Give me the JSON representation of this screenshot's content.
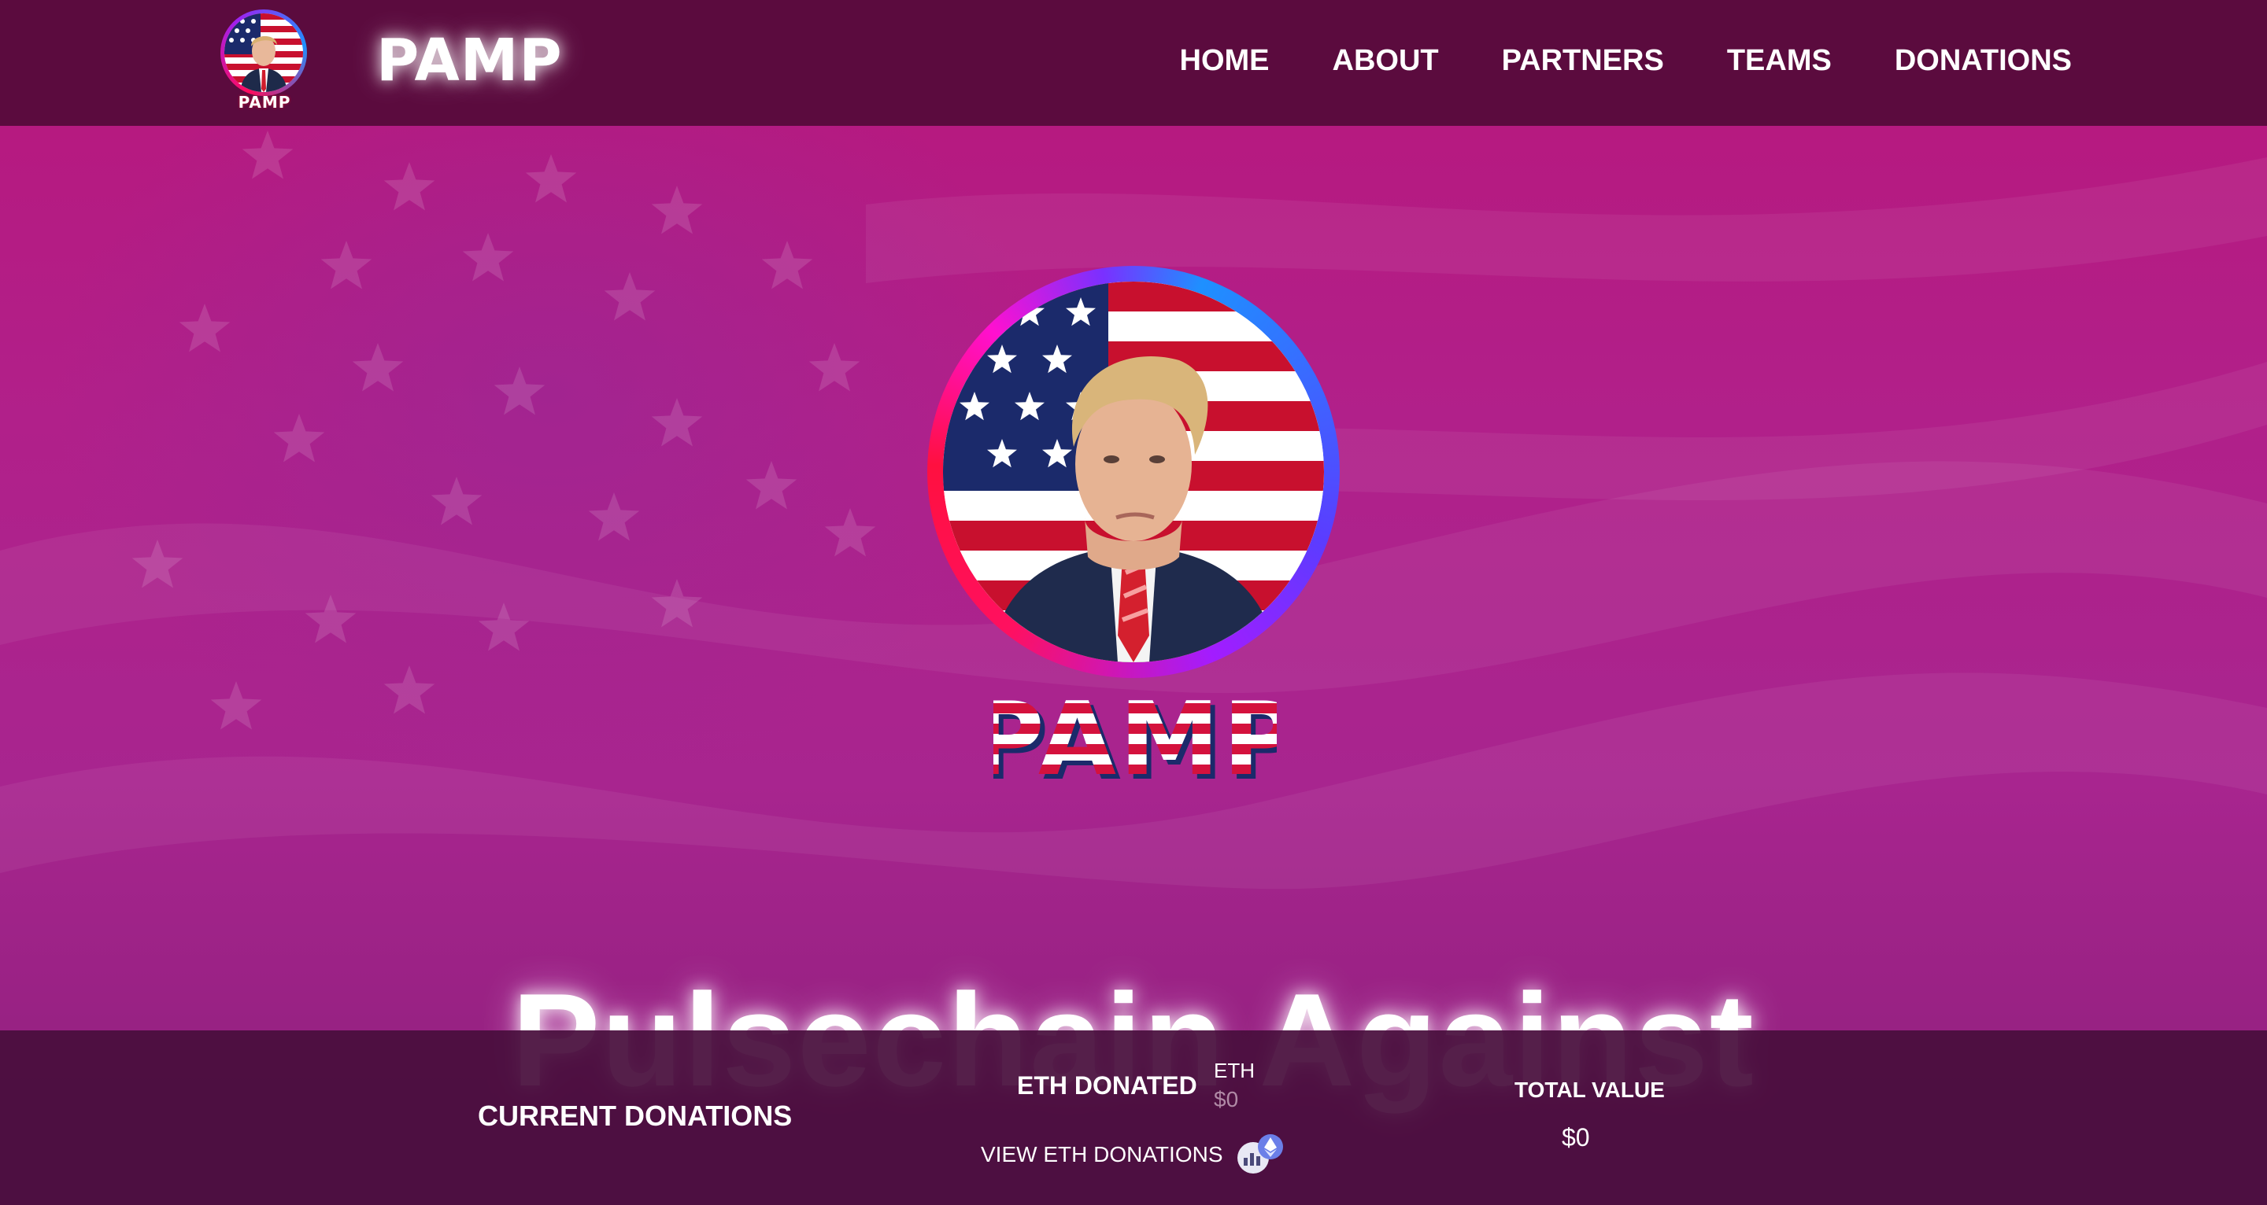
{
  "header": {
    "brand": "PAMP",
    "logo_text": "PAMP",
    "nav": [
      "HOME",
      "ABOUT",
      "PARTNERS",
      "TEAMS",
      "DONATIONS"
    ]
  },
  "hero": {
    "logo_text": "PAMP",
    "headline": "Pulsechain Against"
  },
  "donations": {
    "title": "CURRENT DONATIONS",
    "eth_label": "ETH DONATED",
    "eth_unit": "ETH",
    "eth_value": "$0",
    "view_link": "VIEW ETH DONATIONS",
    "total_label": "TOTAL VALUE",
    "total_value": "$0"
  },
  "colors": {
    "header_bg": "#5b0b3e",
    "hero_bg": "#b01c80",
    "bar_bg": "#480e3c",
    "flag_red": "#c8102e",
    "flag_blue": "#1b2a6b"
  },
  "icons": [
    "portrait-logo-icon",
    "stats-chart-icon",
    "ethereum-icon"
  ]
}
